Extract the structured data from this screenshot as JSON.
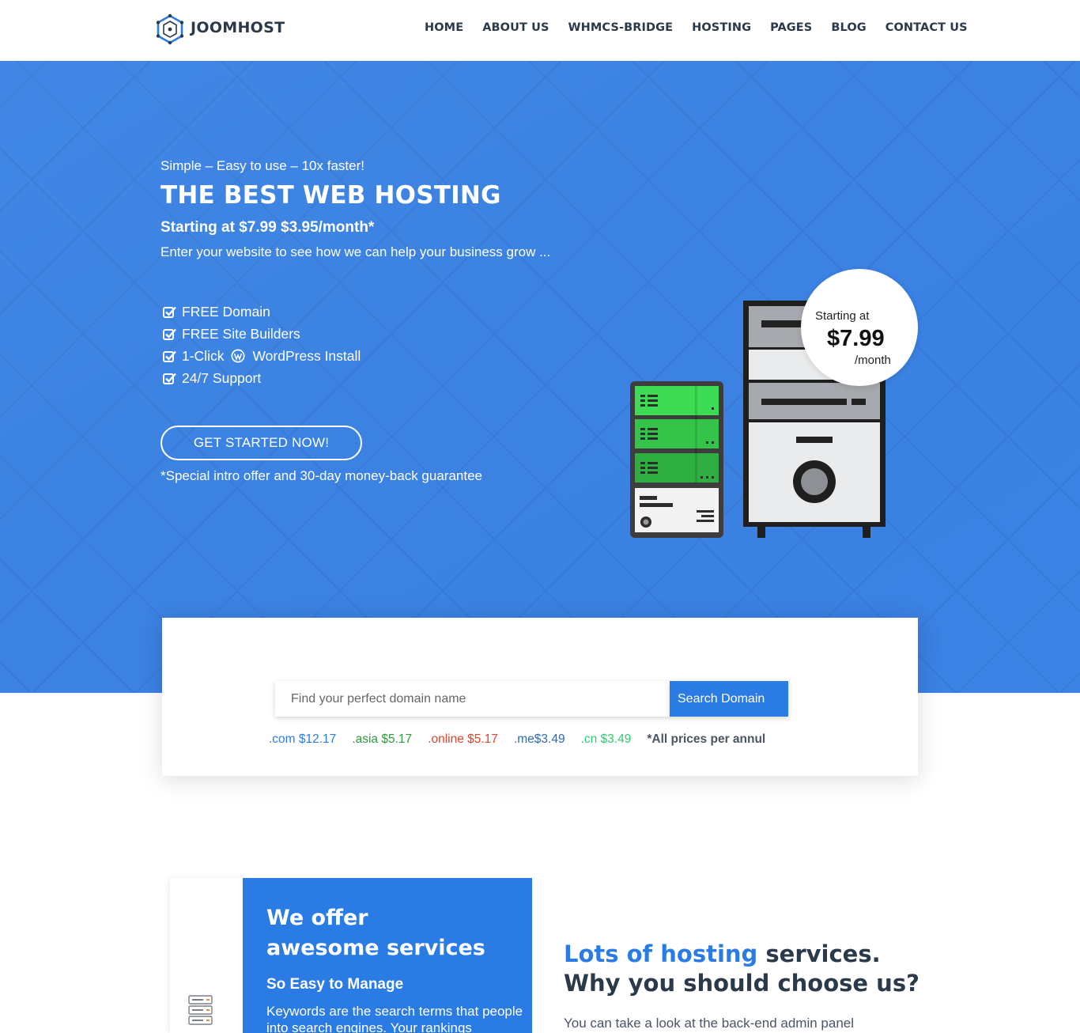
{
  "brand": {
    "name": "JOOMHOST"
  },
  "nav": {
    "items": [
      "HOME",
      "ABOUT US",
      "WHMCS-BRIDGE",
      "HOSTING",
      "PAGES",
      "BLOG",
      "CONTACT US"
    ]
  },
  "hero": {
    "tagline": "Simple – Easy to use – 10x faster!",
    "title": "THE BEST WEB HOSTING",
    "price_line": "Starting at $7.99 $3.95/month*",
    "description": "Enter your website to see how we can help your business grow ...",
    "features": {
      "domain": "FREE Domain",
      "builders": "FREE Site Builders",
      "wp_prefix": "1-Click",
      "wp_suffix": "WordPress Install",
      "support": "24/7 Support"
    },
    "cta_label": "GET STARTED NOW!",
    "guarantee": "*Special intro offer and 30-day money-back guarantee",
    "badge": {
      "starting": "Starting at",
      "price": "$7.99",
      "period": "/month"
    }
  },
  "domain_search": {
    "placeholder": "Find your perfect domain name",
    "button_label": "Search Domain",
    "tlds": [
      {
        "label": ".com $12.17",
        "color": "#2b7be5"
      },
      {
        "label": ".asia $5.17",
        "color": "#2e9b3a"
      },
      {
        "label": ".online $5.17",
        "color": "#e0442c"
      },
      {
        "label": ".me$3.49",
        "color": "#2b6cb0"
      },
      {
        "label": ".cn $3.49",
        "color": "#2ecc71"
      }
    ],
    "note": "*All prices per annul"
  },
  "services": {
    "title_line1": "We offer",
    "title_line2": "awesome services",
    "subtitle": "So Easy to Manage",
    "text": "Keywords are the search terms that people into search engines. Your rankings"
  },
  "choose": {
    "highlight": "Lots of hosting",
    "rest": " services.",
    "line2": "Why you should choose us?",
    "text": "You can take a look at the back-end admin panel"
  },
  "colors": {
    "hero_bg": "#3a82e4",
    "accent": "#2b7be5",
    "heading": "#2b3a4a"
  }
}
